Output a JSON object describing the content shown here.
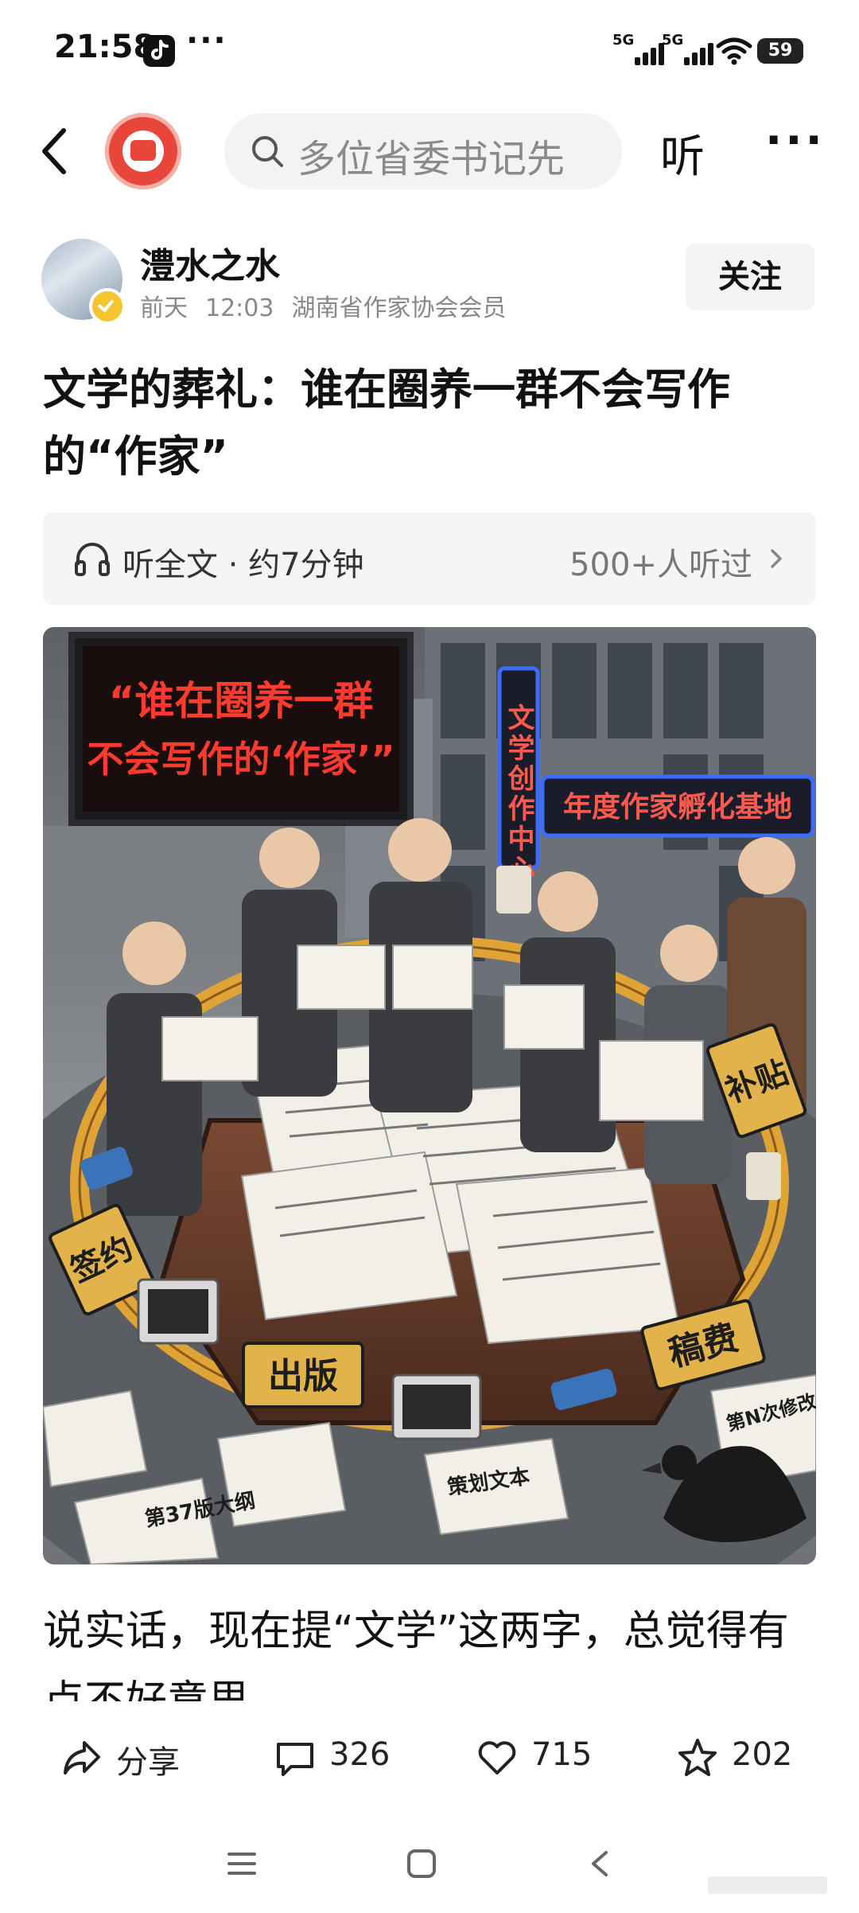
{
  "status_bar": {
    "time": "21:58",
    "more": "···",
    "sim1": "5G",
    "sim2": "5G",
    "battery": "59"
  },
  "top_nav": {
    "search_text": "多位省委书记先",
    "listen_label": "听",
    "more_label": "···"
  },
  "author": {
    "name": "澧水之水",
    "date": "前天",
    "time": "12:03",
    "title": "湖南省作家协会会员",
    "follow_label": "关注"
  },
  "article": {
    "title": "文学的葬礼：谁在圈养一群不会写作的“作家”",
    "listen_label": "听全文 · 约7分钟",
    "listen_count": "500+人听过",
    "body": "说实话，现在提“文学”这两字，总觉得有点不好意思。"
  },
  "illustration": {
    "led_sign_line1": "“谁在圈养一群",
    "led_sign_line2": "不会写作的‘作家’”",
    "vertical_sign": "文学创作中心",
    "horizontal_sign": "年度作家孵化基地",
    "label_sign": "签约",
    "label_publish": "出版",
    "label_fee": "稿费",
    "label_subsidy": "补贴",
    "page_label": "第37版大纲",
    "page_label_2": "第N次修改",
    "page_label_3": "策划文本"
  },
  "actions": {
    "share": "分享",
    "comments": "326",
    "likes": "715",
    "favorites": "202"
  },
  "colors": {
    "accent_red": "#e8463b",
    "badge_gold": "#f5c531",
    "led_red": "#ff3b30",
    "neon_blue": "#3a6cff"
  },
  "icons": {
    "back": "chevron-left-icon",
    "search": "search-icon",
    "headphone": "headphone-icon",
    "share": "share-icon",
    "comment": "comment-icon",
    "like": "heart-icon",
    "favorite": "star-icon",
    "menu": "menu-icon",
    "home": "home-icon",
    "sys_back": "back-icon"
  }
}
